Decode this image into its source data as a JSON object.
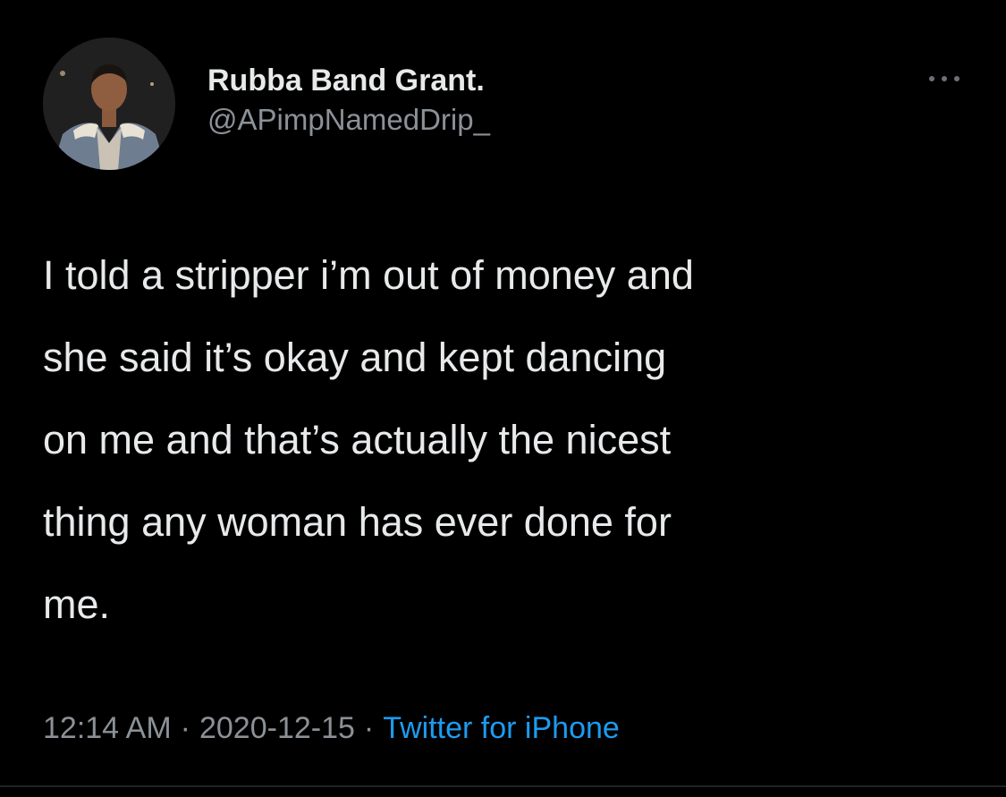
{
  "author": {
    "display_name": "Rubba Band Grant.",
    "handle": "@APimpNamedDrip_"
  },
  "tweet": {
    "lines": [
      "I told a stripper i’m out of money and",
      "she said it’s okay and kept dancing",
      "on me and that’s actually the nicest",
      "thing any woman has ever done for",
      "me."
    ]
  },
  "meta": {
    "time": "12:14 AM",
    "date": "2020-12-15",
    "separator": "·",
    "source": "Twitter for iPhone"
  },
  "icons": {
    "more": "more-options-icon",
    "avatar": "profile-photo"
  },
  "colors": {
    "background": "#000000",
    "text": "#e7e9ea",
    "muted": "#8b9197",
    "link": "#1d9bf0"
  }
}
